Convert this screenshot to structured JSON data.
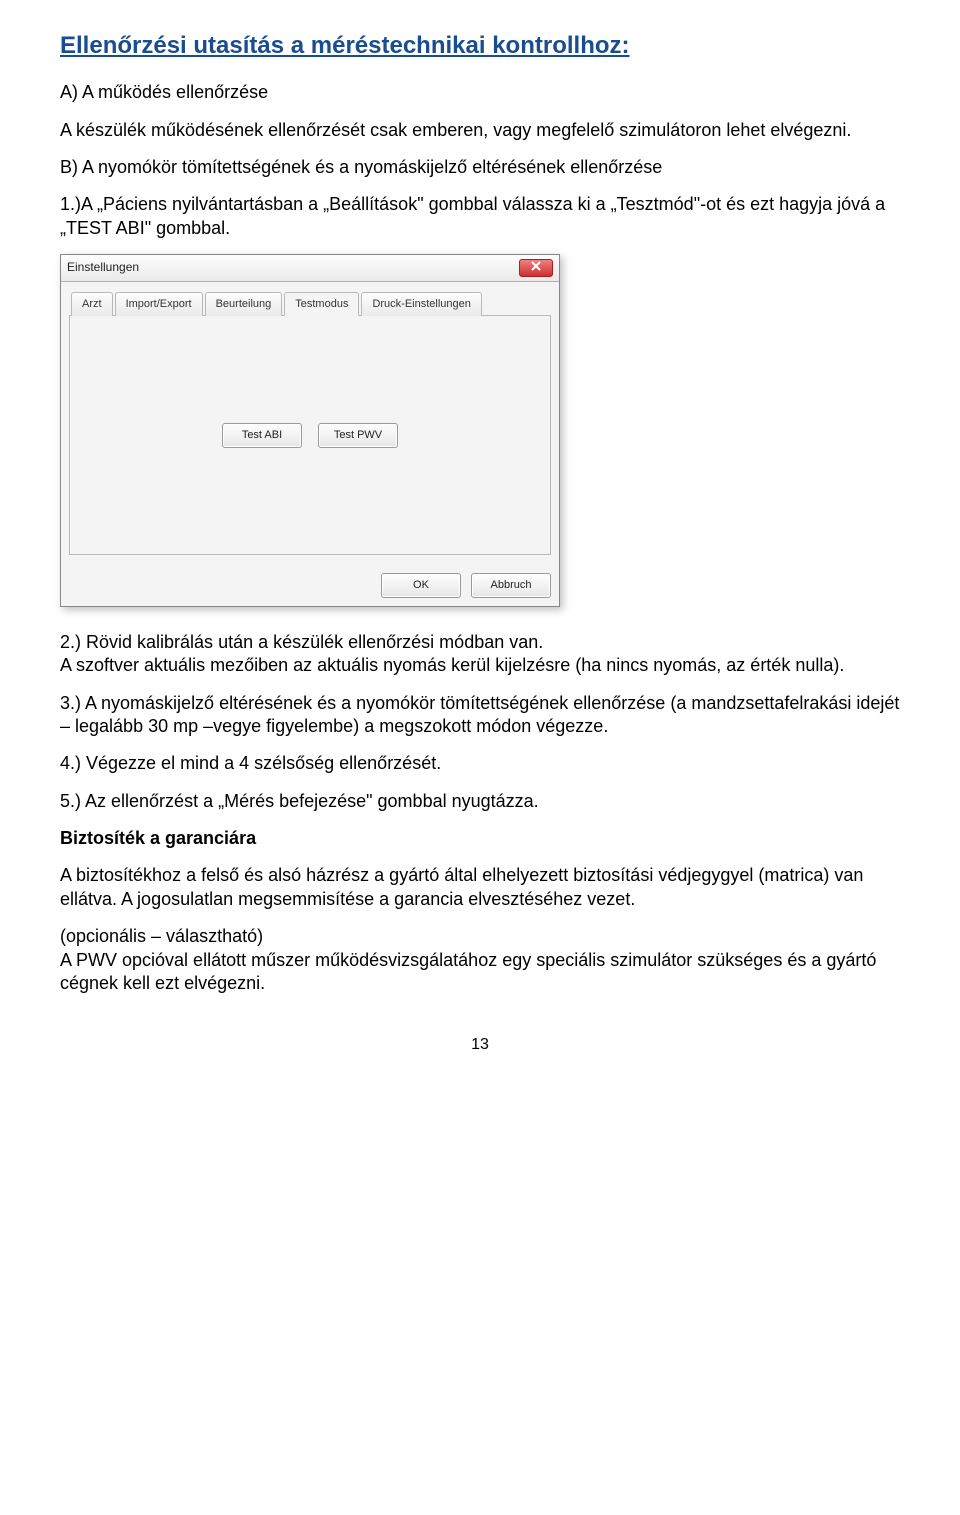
{
  "heading": "Ellenőrzési utasítás a méréstechnikai kontrollhoz:",
  "section_a": "A) A működés ellenőrzése",
  "para_a": "A készülék működésének ellenőrzését csak emberen, vagy megfelelő szimulátoron lehet elvégezni.",
  "section_b": "B) A nyomókör tömítettségének és a nyomáskijelző eltérésének ellenőrzése",
  "para_b1": "1.)A „Páciens nyilvántartásban  a „Beállítások\" gombbal válassza ki a „Tesztmód\"-ot és ezt hagyja jóvá a „TEST ABI\" gombbal.",
  "dialog": {
    "title": "Einstellungen",
    "tabs": [
      "Arzt",
      "Import/Export",
      "Beurteilung",
      "Testmodus",
      "Druck-Einstellungen"
    ],
    "active_tab_index": 3,
    "btn_test_abi": "Test ABI",
    "btn_test_pwv": "Test PWV",
    "btn_ok": "OK",
    "btn_cancel": "Abbruch"
  },
  "para_2a": "2.) Rövid kalibrálás után a készülék ellenőrzési módban van.",
  "para_2b": "A szoftver aktuális mezőiben az aktuális nyomás kerül kijelzésre (ha nincs nyomás, az érték nulla).",
  "para_3": "3.) A nyomáskijelző eltérésének és a nyomókör tömítettségének ellenőrzése (a mandzsettafelrakási idejét – legalább 30 mp –vegye figyelembe) a megszokott módon végezze.",
  "para_4": "4.) Végezze el mind a 4 szélsőség ellenőrzését.",
  "para_5": "5.) Az ellenőrzést a „Mérés befejezése\" gombbal nyugtázza.",
  "warranty_heading": "Biztosíték a garanciára",
  "warranty_para": "A biztosítékhoz a felső és alsó házrész a gyártó által elhelyezett biztosítási védjegygyel (matrica) van ellátva. A jogosulatlan megsemmisítése a garancia elvesztéséhez vezet.",
  "opt_a": "(opcionális – választható)",
  "opt_b": "A PWV opcióval ellátott műszer működésvizsgálatához egy speciális szimulátor szükséges és a gyártó cégnek kell ezt elvégezni.",
  "page_number": "13"
}
